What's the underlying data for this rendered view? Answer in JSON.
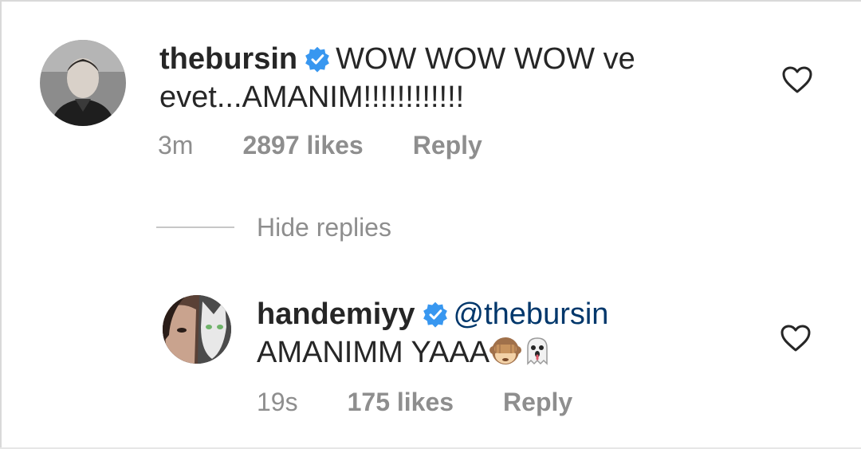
{
  "colors": {
    "text": "#262626",
    "secondary": "#8e8e8e",
    "mention": "#00376b",
    "verified": "#3897f0"
  },
  "comment": {
    "username": "thebursin",
    "text": "WOW WOW WOW ve evet...AMANIM!!!!!!!!!!!!",
    "time": "3m",
    "likes": "2897 likes",
    "reply_label": "Reply"
  },
  "hide_replies": {
    "label": "Hide replies"
  },
  "reply": {
    "username": "handemiyy",
    "mention": "@thebursin",
    "text": "AMANIMM YAAA",
    "emojis": [
      "see-no-evil-monkey-icon",
      "ghost-icon"
    ],
    "time": "19s",
    "likes": "175 likes",
    "reply_label": "Reply"
  }
}
